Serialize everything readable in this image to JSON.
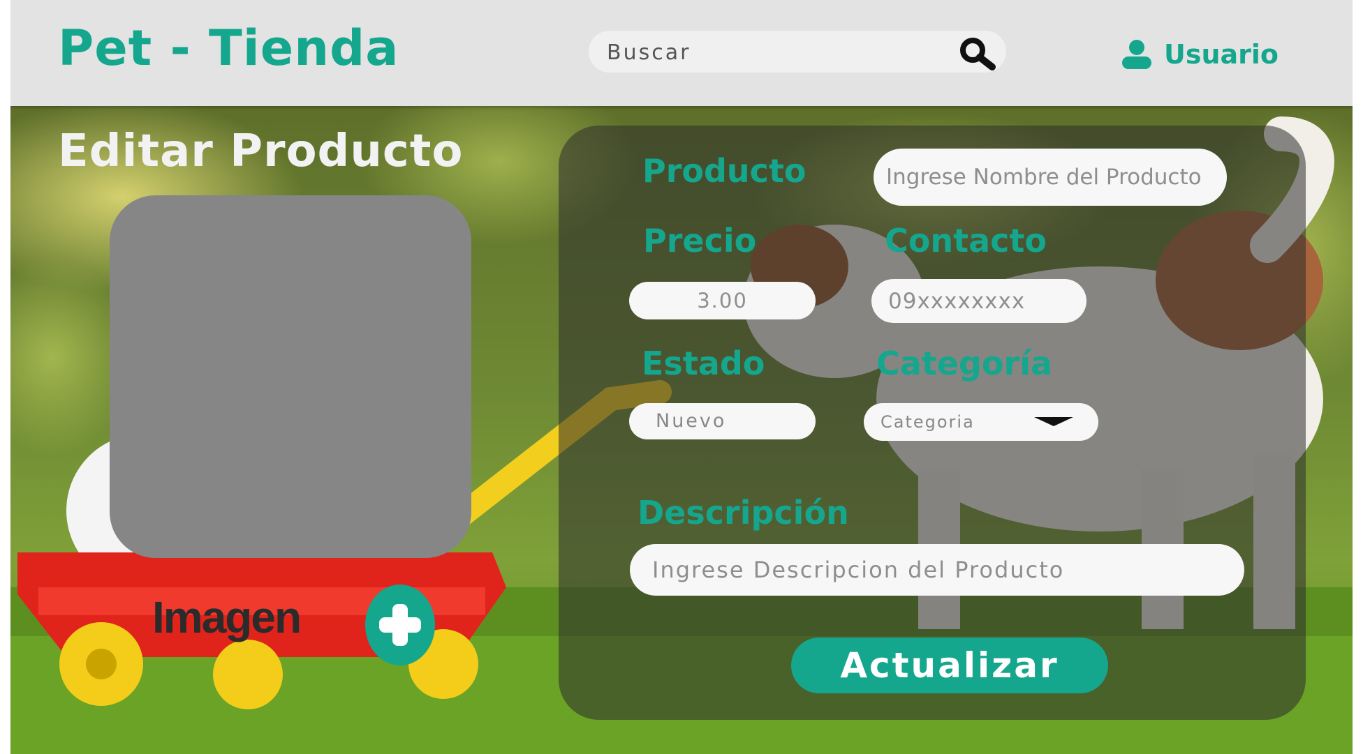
{
  "header": {
    "brand": "Pet - Tienda",
    "search_placeholder": "Buscar",
    "user_label": "Usuario"
  },
  "page": {
    "title": "Editar Producto",
    "image_label": "Imagen"
  },
  "form": {
    "producto": {
      "label": "Producto",
      "placeholder": "Ingrese Nombre del Producto"
    },
    "precio": {
      "label": "Precio",
      "placeholder": "3.00"
    },
    "contacto": {
      "label": "Contacto",
      "placeholder": "09xxxxxxxx"
    },
    "estado": {
      "label": "Estado",
      "value": "Nuevo"
    },
    "categoria": {
      "label": "Categoría",
      "value": "Categoria"
    },
    "descripcion": {
      "label": "Descripción",
      "placeholder": "Ingrese Descripcion del Producto"
    },
    "submit_label": "Actualizar"
  },
  "colors": {
    "accent": "#15a68e",
    "header_bg": "#e3e3e3",
    "panel_bg": "rgba(45,45,45,0.55)",
    "image_placeholder": "#868686"
  },
  "icons": {
    "search": "search-icon",
    "user": "user-icon",
    "add": "plus-icon",
    "dropdown": "chevron-down-icon"
  }
}
